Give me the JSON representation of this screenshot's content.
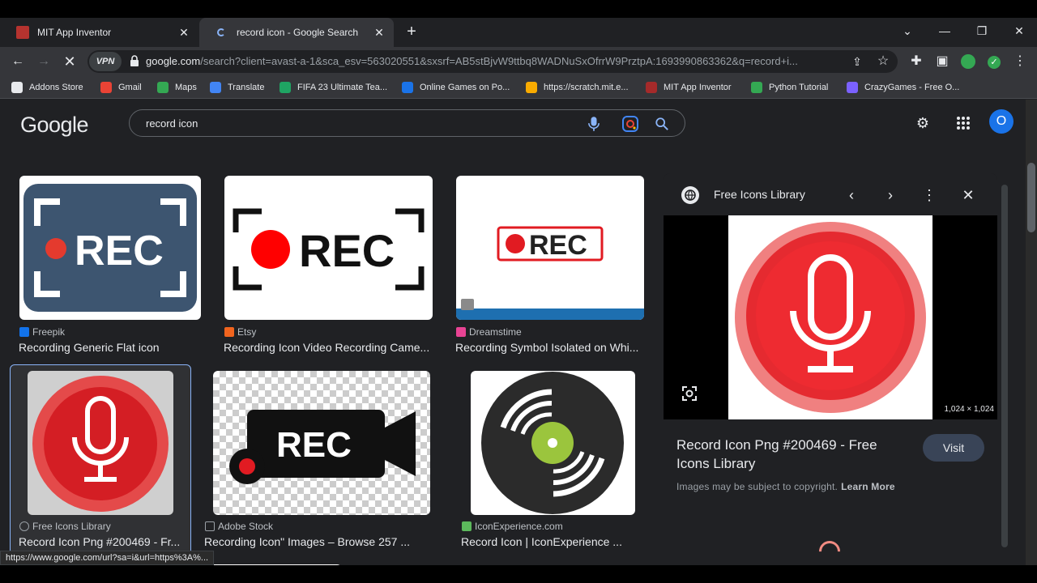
{
  "tabs": [
    {
      "title": "MIT App Inventor"
    },
    {
      "title": "record icon - Google Search"
    }
  ],
  "window": {
    "minimize": "—",
    "restore": "❐",
    "close": "✕",
    "tab_search": "⌄"
  },
  "toolbar": {
    "vpn_label": "VPN",
    "url_host": "google.com",
    "url_rest": "/search?client=avast-a-1&sca_esv=563020551&sxsrf=AB5stBjvW9ttbq8WADNuSxOfrrW9PrztpA:1693990863362&q=record+i..."
  },
  "bookmarks": [
    {
      "label": "Addons Store",
      "color": "#e8eaed"
    },
    {
      "label": "Gmail",
      "color": "#ea4335"
    },
    {
      "label": "Maps",
      "color": "#34a853"
    },
    {
      "label": "Translate",
      "color": "#4285f4"
    },
    {
      "label": "FIFA 23 Ultimate Tea...",
      "color": "#1fa463"
    },
    {
      "label": "Online Games on Po...",
      "color": "#1a73e8"
    },
    {
      "label": "https://scratch.mit.e...",
      "color": "#f9ab00"
    },
    {
      "label": "MIT App Inventor",
      "color": "#a52a2a"
    },
    {
      "label": "Python Tutorial",
      "color": "#34a853"
    },
    {
      "label": "CrazyGames - Free O...",
      "color": "#7b61ff"
    }
  ],
  "header": {
    "logo": "Google",
    "query": "record icon",
    "avatar_letter": "O"
  },
  "results": [
    {
      "source": "Freepik",
      "title": "Recording Generic Flat icon",
      "src_color": "#1273eb"
    },
    {
      "source": "Etsy",
      "title": "Recording Icon Video Recording Came...",
      "src_color": "#f1641e"
    },
    {
      "source": "Dreamstime",
      "title": "Recording Symbol Isolated on Whi...",
      "src_color": "#e84393"
    },
    {
      "source": "Free Icons Library",
      "title": "Record Icon Png #200469 - Fr...",
      "src_color": "#9aa0a6"
    },
    {
      "source": "Adobe Stock",
      "title": "Recording Icon\" Images – Browse 257 ...",
      "src_color": "#9aa0a6"
    },
    {
      "source": "IconExperience.com",
      "title": "Record Icon | IconExperience ...",
      "src_color": "#5cb85c"
    }
  ],
  "thumb_text": {
    "rec": "REC"
  },
  "panel": {
    "source": "Free Icons Library",
    "dims": "1,024 × 1,024",
    "title": "Record Icon Png #200469 - Free Icons Library",
    "visit": "Visit",
    "copyright": "Images may be subject to copyright.",
    "learn_more": "Learn More"
  },
  "status_url": "https://www.google.com/url?sa=i&url=https%3A%..."
}
